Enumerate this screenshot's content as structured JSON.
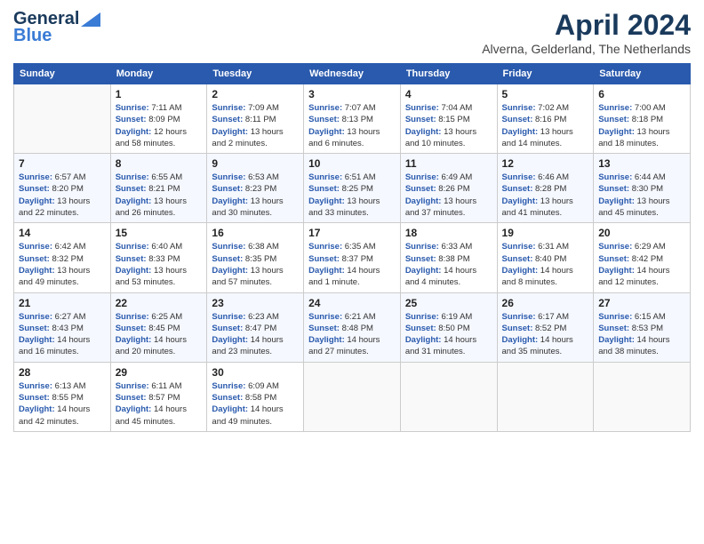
{
  "logo": {
    "line1": "General",
    "line2": "Blue"
  },
  "title": "April 2024",
  "location": "Alverna, Gelderland, The Netherlands",
  "days_header": [
    "Sunday",
    "Monday",
    "Tuesday",
    "Wednesday",
    "Thursday",
    "Friday",
    "Saturday"
  ],
  "weeks": [
    [
      {
        "num": "",
        "empty": true
      },
      {
        "num": "1",
        "sunrise": "7:11 AM",
        "sunset": "8:09 PM",
        "daylight": "12 hours and 58 minutes."
      },
      {
        "num": "2",
        "sunrise": "7:09 AM",
        "sunset": "8:11 PM",
        "daylight": "13 hours and 2 minutes."
      },
      {
        "num": "3",
        "sunrise": "7:07 AM",
        "sunset": "8:13 PM",
        "daylight": "13 hours and 6 minutes."
      },
      {
        "num": "4",
        "sunrise": "7:04 AM",
        "sunset": "8:15 PM",
        "daylight": "13 hours and 10 minutes."
      },
      {
        "num": "5",
        "sunrise": "7:02 AM",
        "sunset": "8:16 PM",
        "daylight": "13 hours and 14 minutes."
      },
      {
        "num": "6",
        "sunrise": "7:00 AM",
        "sunset": "8:18 PM",
        "daylight": "13 hours and 18 minutes."
      }
    ],
    [
      {
        "num": "7",
        "sunrise": "6:57 AM",
        "sunset": "8:20 PM",
        "daylight": "13 hours and 22 minutes."
      },
      {
        "num": "8",
        "sunrise": "6:55 AM",
        "sunset": "8:21 PM",
        "daylight": "13 hours and 26 minutes."
      },
      {
        "num": "9",
        "sunrise": "6:53 AM",
        "sunset": "8:23 PM",
        "daylight": "13 hours and 30 minutes."
      },
      {
        "num": "10",
        "sunrise": "6:51 AM",
        "sunset": "8:25 PM",
        "daylight": "13 hours and 33 minutes."
      },
      {
        "num": "11",
        "sunrise": "6:49 AM",
        "sunset": "8:26 PM",
        "daylight": "13 hours and 37 minutes."
      },
      {
        "num": "12",
        "sunrise": "6:46 AM",
        "sunset": "8:28 PM",
        "daylight": "13 hours and 41 minutes."
      },
      {
        "num": "13",
        "sunrise": "6:44 AM",
        "sunset": "8:30 PM",
        "daylight": "13 hours and 45 minutes."
      }
    ],
    [
      {
        "num": "14",
        "sunrise": "6:42 AM",
        "sunset": "8:32 PM",
        "daylight": "13 hours and 49 minutes."
      },
      {
        "num": "15",
        "sunrise": "6:40 AM",
        "sunset": "8:33 PM",
        "daylight": "13 hours and 53 minutes."
      },
      {
        "num": "16",
        "sunrise": "6:38 AM",
        "sunset": "8:35 PM",
        "daylight": "13 hours and 57 minutes."
      },
      {
        "num": "17",
        "sunrise": "6:35 AM",
        "sunset": "8:37 PM",
        "daylight": "14 hours and 1 minute."
      },
      {
        "num": "18",
        "sunrise": "6:33 AM",
        "sunset": "8:38 PM",
        "daylight": "14 hours and 4 minutes."
      },
      {
        "num": "19",
        "sunrise": "6:31 AM",
        "sunset": "8:40 PM",
        "daylight": "14 hours and 8 minutes."
      },
      {
        "num": "20",
        "sunrise": "6:29 AM",
        "sunset": "8:42 PM",
        "daylight": "14 hours and 12 minutes."
      }
    ],
    [
      {
        "num": "21",
        "sunrise": "6:27 AM",
        "sunset": "8:43 PM",
        "daylight": "14 hours and 16 minutes."
      },
      {
        "num": "22",
        "sunrise": "6:25 AM",
        "sunset": "8:45 PM",
        "daylight": "14 hours and 20 minutes."
      },
      {
        "num": "23",
        "sunrise": "6:23 AM",
        "sunset": "8:47 PM",
        "daylight": "14 hours and 23 minutes."
      },
      {
        "num": "24",
        "sunrise": "6:21 AM",
        "sunset": "8:48 PM",
        "daylight": "14 hours and 27 minutes."
      },
      {
        "num": "25",
        "sunrise": "6:19 AM",
        "sunset": "8:50 PM",
        "daylight": "14 hours and 31 minutes."
      },
      {
        "num": "26",
        "sunrise": "6:17 AM",
        "sunset": "8:52 PM",
        "daylight": "14 hours and 35 minutes."
      },
      {
        "num": "27",
        "sunrise": "6:15 AM",
        "sunset": "8:53 PM",
        "daylight": "14 hours and 38 minutes."
      }
    ],
    [
      {
        "num": "28",
        "sunrise": "6:13 AM",
        "sunset": "8:55 PM",
        "daylight": "14 hours and 42 minutes."
      },
      {
        "num": "29",
        "sunrise": "6:11 AM",
        "sunset": "8:57 PM",
        "daylight": "14 hours and 45 minutes."
      },
      {
        "num": "30",
        "sunrise": "6:09 AM",
        "sunset": "8:58 PM",
        "daylight": "14 hours and 49 minutes."
      },
      {
        "num": "",
        "empty": true
      },
      {
        "num": "",
        "empty": true
      },
      {
        "num": "",
        "empty": true
      },
      {
        "num": "",
        "empty": true
      }
    ]
  ]
}
